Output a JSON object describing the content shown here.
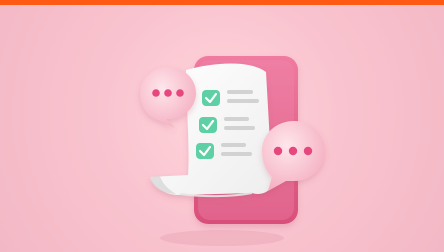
{
  "colors": {
    "top_bar": "#ff5a14",
    "background": "#f9c4cf",
    "paper": "#f8f8f8",
    "tablet": "#e8648d",
    "check": "#5fd0a5",
    "bubble": "#f7b6c7",
    "dots": "#e6477d"
  },
  "icons": {
    "bubble_left": "speech-bubble-icon",
    "bubble_right": "speech-bubble-icon",
    "check": "checkmark-icon",
    "document": "document-icon"
  },
  "checklist": {
    "items": [
      {
        "checked": true
      },
      {
        "checked": true
      },
      {
        "checked": true
      }
    ]
  }
}
